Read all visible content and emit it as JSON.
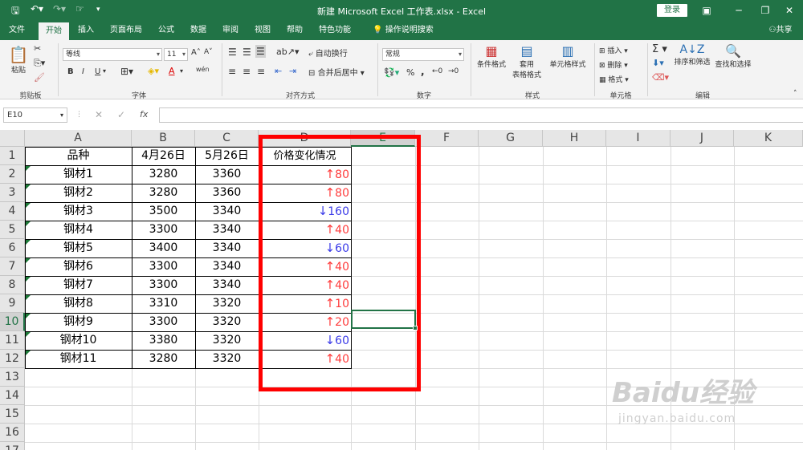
{
  "window": {
    "title": "新建 Microsoft Excel 工作表.xlsx - Excel",
    "login_label": "登录"
  },
  "quick_access": {
    "save": "save-icon",
    "undo": "undo-icon",
    "redo": "redo-icon",
    "touch": "touch-mode-icon"
  },
  "tabs": [
    "文件",
    "开始",
    "插入",
    "页面布局",
    "公式",
    "数据",
    "审阅",
    "视图",
    "帮助",
    "特色功能",
    "操作说明搜索"
  ],
  "share_label": "共享",
  "ribbon": {
    "clipboard": {
      "paste": "粘贴",
      "group": "剪贴板"
    },
    "font": {
      "name": "等线",
      "size": "11",
      "group": "字体",
      "bold": "B",
      "italic": "I",
      "underline": "U",
      "grow": "A˄",
      "shrink": "A˅",
      "wen": "wén",
      "fontcolor": "A"
    },
    "align": {
      "wrap": "自动换行",
      "merge": "合并后居中",
      "group": "对齐方式"
    },
    "number": {
      "format": "常规",
      "group": "数字",
      "percent": "%",
      "comma": ","
    },
    "styles": {
      "cond": "条件格式",
      "table_line1": "套用",
      "table_line2": "表格格式",
      "cell": "单元格样式",
      "group": "样式"
    },
    "cells": {
      "insert": "插入",
      "delete": "删除",
      "format": "格式",
      "group": "单元格"
    },
    "editing": {
      "sort": "排序和筛选",
      "find": "查找和选择",
      "group": "编辑"
    }
  },
  "formula_bar": {
    "name_box": "E10",
    "fx": "fx",
    "value": ""
  },
  "columns": [
    "A",
    "B",
    "C",
    "D",
    "E",
    "F",
    "G",
    "H",
    "I",
    "J",
    "K"
  ],
  "rows": [
    "1",
    "2",
    "3",
    "4",
    "5",
    "6",
    "7",
    "8",
    "9",
    "10",
    "11",
    "12",
    "13",
    "14",
    "15",
    "16",
    "17"
  ],
  "table": {
    "headers": [
      "品种",
      "4月26日",
      "5月26日",
      "价格变化情况"
    ],
    "rows": [
      {
        "name": "钢材1",
        "apr": "3280",
        "may": "3360",
        "dir": "up",
        "arrow": "↑",
        "change": "80"
      },
      {
        "name": "钢材2",
        "apr": "3280",
        "may": "3360",
        "dir": "up",
        "arrow": "↑",
        "change": "80"
      },
      {
        "name": "钢材3",
        "apr": "3500",
        "may": "3340",
        "dir": "down",
        "arrow": "↓",
        "change": "160"
      },
      {
        "name": "钢材4",
        "apr": "3300",
        "may": "3340",
        "dir": "up",
        "arrow": "↑",
        "change": "40"
      },
      {
        "name": "钢材5",
        "apr": "3400",
        "may": "3340",
        "dir": "down",
        "arrow": "↓",
        "change": "60"
      },
      {
        "name": "钢材6",
        "apr": "3300",
        "may": "3340",
        "dir": "up",
        "arrow": "↑",
        "change": "40"
      },
      {
        "name": "钢材7",
        "apr": "3300",
        "may": "3340",
        "dir": "up",
        "arrow": "↑",
        "change": "40"
      },
      {
        "name": "钢材8",
        "apr": "3310",
        "may": "3320",
        "dir": "up",
        "arrow": "↑",
        "change": "10"
      },
      {
        "name": "钢材9",
        "apr": "3300",
        "may": "3320",
        "dir": "up",
        "arrow": "↑",
        "change": "20"
      },
      {
        "name": "钢材10",
        "apr": "3380",
        "may": "3320",
        "dir": "down",
        "arrow": "↓",
        "change": "60"
      },
      {
        "name": "钢材11",
        "apr": "3280",
        "may": "3320",
        "dir": "up",
        "arrow": "↑",
        "change": "40"
      }
    ]
  },
  "colors": {
    "excel_green": "#217346",
    "up": "#ff3b3b",
    "down": "#3a3ae8",
    "highlight": "#ff0000"
  },
  "watermark": {
    "logo": "Baidu经验",
    "url": "jingyan.baidu.com"
  }
}
